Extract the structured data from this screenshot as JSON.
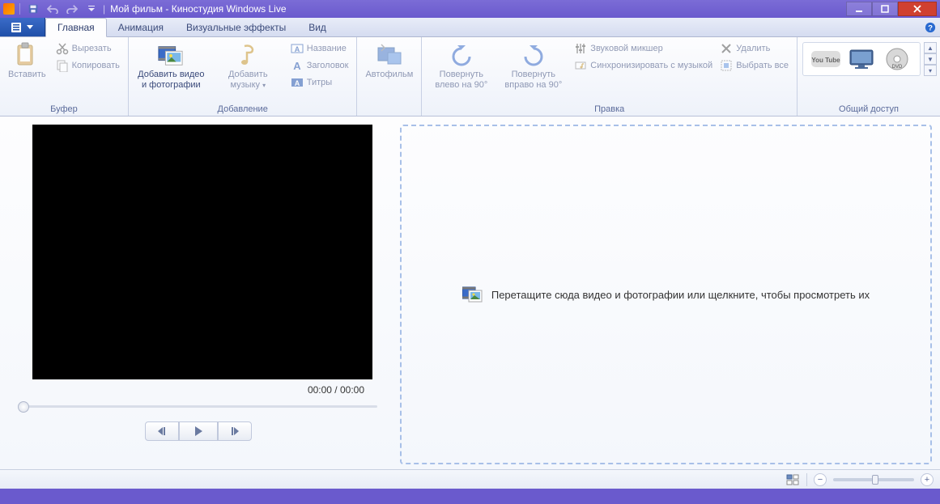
{
  "title": "Мой фильм - Киностудия Windows Live",
  "tabs": {
    "home": "Главная",
    "animation": "Анимация",
    "effects": "Визуальные эффекты",
    "view": "Вид"
  },
  "groups": {
    "clipboard": {
      "label": "Буфер",
      "paste": "Вставить",
      "cut": "Вырезать",
      "copy": "Копировать"
    },
    "add": {
      "label": "Добавление",
      "add_media": "Добавить видео и фотографии",
      "add_music": "Добавить музыку",
      "title": "Название",
      "caption": "Заголовок",
      "credits": "Титры"
    },
    "automovie": {
      "label": "Автофильм"
    },
    "edit": {
      "label": "Правка",
      "rotate_left": "Повернуть влево на 90°",
      "rotate_right": "Повернуть вправо на 90°",
      "audio_mixer": "Звуковой микшер",
      "sync_music": "Синхронизировать с музыкой",
      "delete": "Удалить",
      "select_all": "Выбрать все"
    },
    "share": {
      "label": "Общий доступ"
    }
  },
  "preview": {
    "time": "00:00 / 00:00"
  },
  "timeline": {
    "drop_hint": "Перетащите сюда видео и фотографии или щелкните, чтобы просмотреть их"
  }
}
